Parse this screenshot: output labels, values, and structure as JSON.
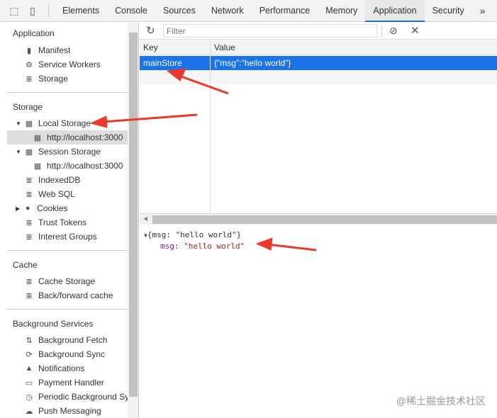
{
  "tabs": [
    "Elements",
    "Console",
    "Sources",
    "Network",
    "Performance",
    "Memory",
    "Application",
    "Security"
  ],
  "more_tabs": "»",
  "sidebar": {
    "application": {
      "title": "Application",
      "items": [
        "Manifest",
        "Service Workers",
        "Storage"
      ]
    },
    "storage": {
      "title": "Storage",
      "items": [
        "Local Storage",
        "http://localhost:3000",
        "Session Storage",
        "http://localhost:3000",
        "IndexedDB",
        "Web SQL",
        "Cookies",
        "Trust Tokens",
        "Interest Groups"
      ]
    },
    "cache": {
      "title": "Cache",
      "items": [
        "Cache Storage",
        "Back/forward cache"
      ]
    },
    "background": {
      "title": "Background Services",
      "items": [
        "Background Fetch",
        "Background Sync",
        "Notifications",
        "Payment Handler",
        "Periodic Background Sync",
        "Push Messaging"
      ]
    }
  },
  "filter": {
    "placeholder": "Filter"
  },
  "table": {
    "headers": [
      "Key",
      "Value"
    ],
    "rows": [
      {
        "key": "mainStore",
        "value": "{\"msg\":\"hello world\"}"
      }
    ]
  },
  "preview": {
    "summary": "{msg: \"hello world\"}",
    "prop_key": "msg",
    "prop_sep": ": ",
    "prop_value": "\"hello world\""
  },
  "watermark": "@稀土掘金技术社区",
  "colors": {
    "accent": "#1a73e8",
    "arrow": "#e8392b"
  }
}
